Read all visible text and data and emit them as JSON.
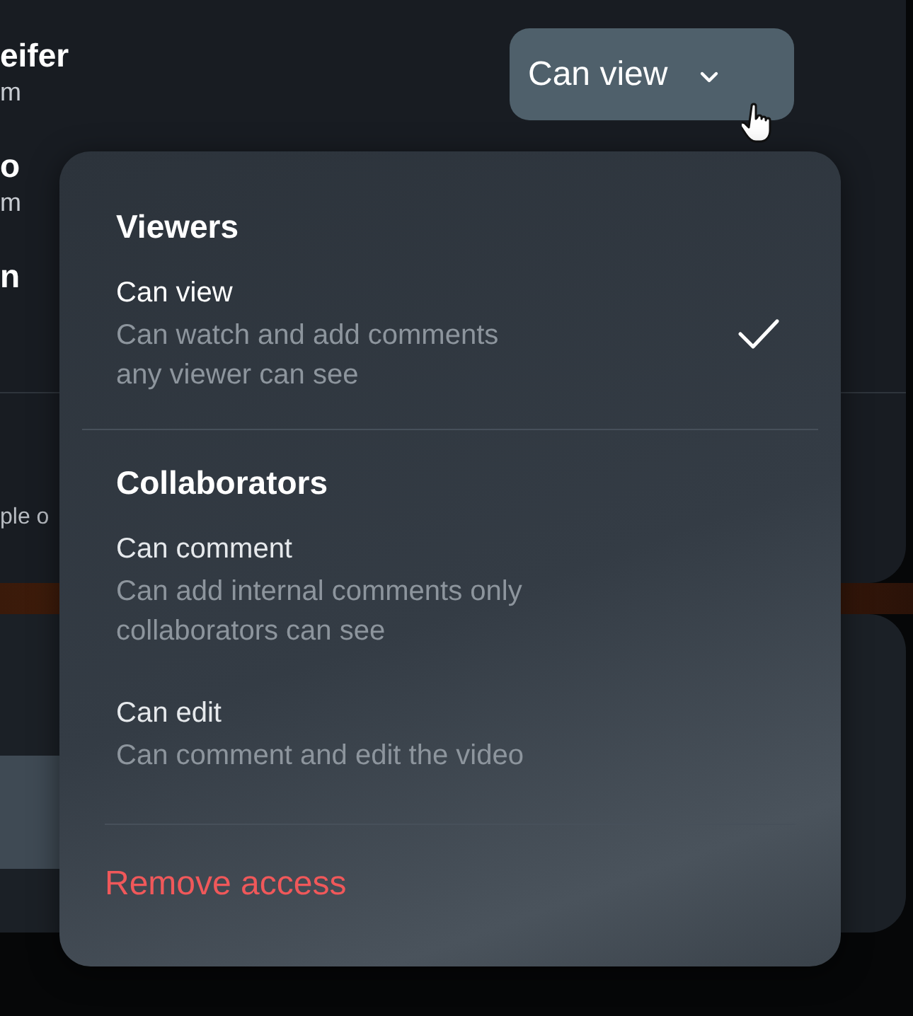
{
  "share_list": {
    "people": [
      {
        "name": "eifer",
        "detail": "m"
      },
      {
        "name": "o",
        "detail": "m"
      },
      {
        "name": "n"
      }
    ],
    "note": "ple o"
  },
  "access_button": {
    "label": "Can view"
  },
  "menu": {
    "sections": [
      {
        "title": "Viewers",
        "options": [
          {
            "label": "Can view",
            "description": [
              "Can watch and add comments",
              "any viewer can see"
            ],
            "selected": true
          }
        ]
      },
      {
        "title": "Collaborators",
        "options": [
          {
            "label": "Can comment",
            "description": [
              "Can add internal comments only",
              "collaborators can see"
            ],
            "selected": false
          },
          {
            "label": "Can edit",
            "description": [
              "Can comment and edit the video"
            ],
            "selected": false
          }
        ]
      }
    ],
    "remove": {
      "label": "Remove access"
    }
  }
}
